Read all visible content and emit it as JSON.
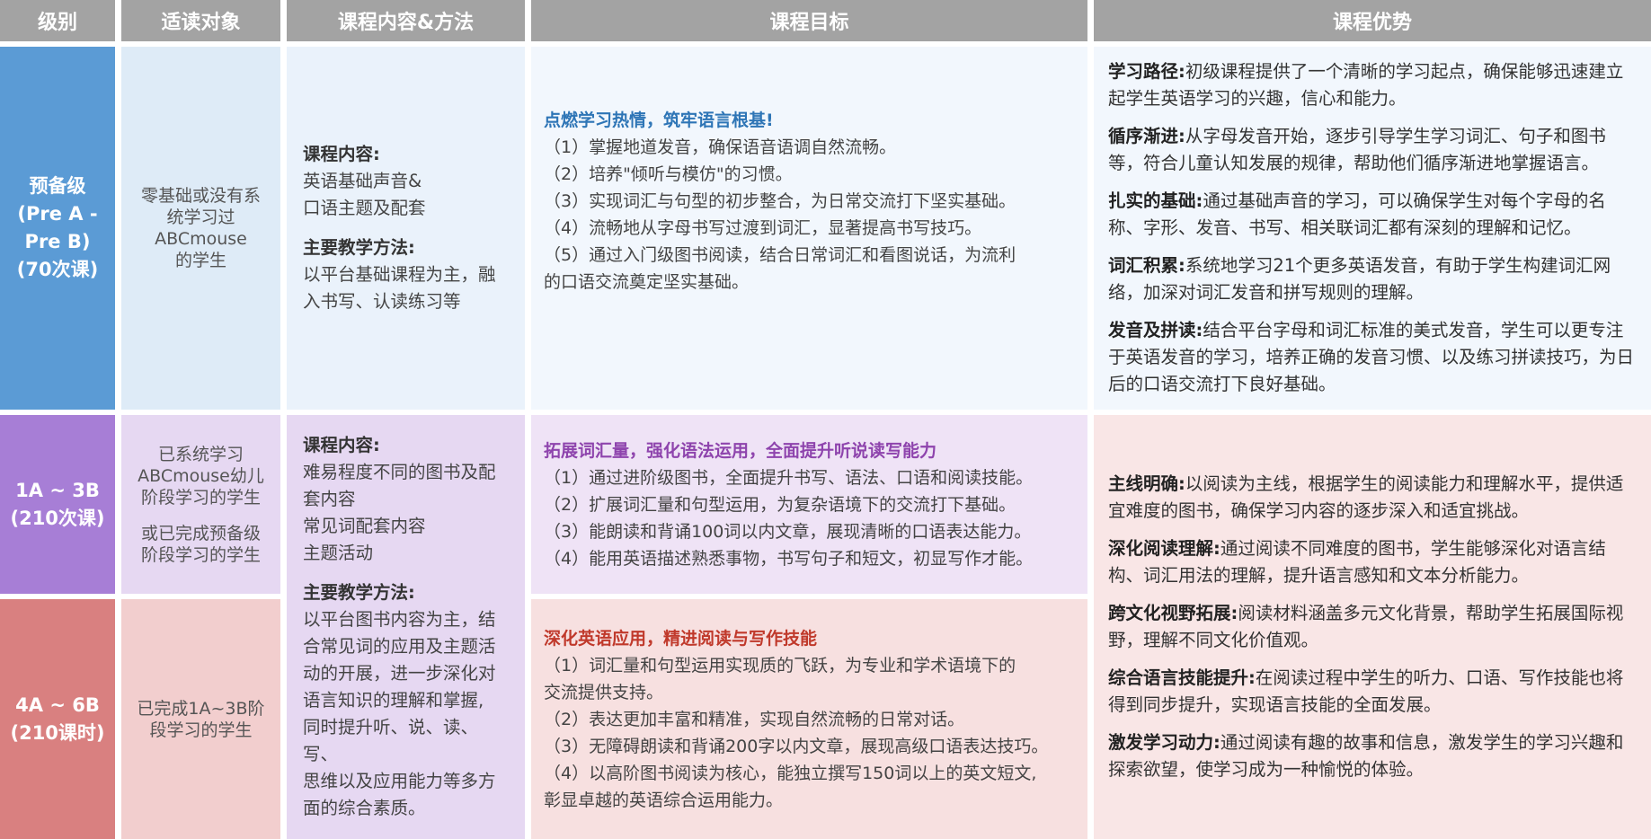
{
  "headers": [
    "级别",
    "适读对象",
    "课程内容&方法",
    "课程目标",
    "课程优势"
  ],
  "rows": {
    "pre": {
      "level": [
        "预备级",
        "(Pre A -",
        "Pre B)",
        "(70次课)"
      ],
      "target": [
        "零基础或没有系",
        "统学习过",
        "ABCmouse",
        "的学生"
      ],
      "content_label": "课程内容:",
      "content_lines": [
        "英语基础声音&",
        "口语主题及配套"
      ],
      "method_label": "主要教学方法:",
      "method_lines": [
        "以平台基础课程为主，融",
        "入书写、认读练习等"
      ],
      "goal_title": "点燃学习热情，筑牢语言根基!",
      "goal_lines": [
        "（1）掌握地道发音，确保语音语调自然流畅。",
        "（2）培养\"倾听与模仿\"的习惯。",
        "（3）实现词汇与句型的初步整合，为日常交流打下坚实基础。",
        "（4）流畅地从字母书写过渡到词汇，显著提高书写技巧。",
        "（5）通过入门级图书阅读，结合日常词汇和看图说话，为流利",
        "的口语交流奠定坚实基础。"
      ],
      "advantages": [
        {
          "key": "学习路径:",
          "text": "初级课程提供了一个清晰的学习起点，确保能够迅速建立起学生英语学习的兴趣，信心和能力。"
        },
        {
          "key": "循序渐进:",
          "text": "从字母发音开始，逐步引导学生学习词汇、句子和图书等，符合儿童认知发展的规律，帮助他们循序渐进地掌握语言。"
        },
        {
          "key": "扎实的基础:",
          "text": "通过基础声音的学习，可以确保学生对每个字母的名称、字形、发音、书写、相关联词汇都有深刻的理解和记忆。"
        },
        {
          "key": "词汇积累:",
          "text": "系统地学习21个更多英语发音，有助于学生构建词汇网络，加深对词汇发音和拼写规则的理解。"
        },
        {
          "key": "发音及拼读:",
          "text": "结合平台字母和词汇标准的美式发音，学生可以更专注于英语发音的学习，培养正确的发音习惯、以及练习拼读技巧，为日后的口语交流打下良好基础。"
        }
      ]
    },
    "a": {
      "level": [
        "1A ~ 3B",
        "(210次课)"
      ],
      "target1": [
        "已系统学习",
        "ABCmouse幼儿",
        "阶段学习的学生"
      ],
      "target2": [
        "或已完成预备级",
        "阶段学习的学生"
      ],
      "goal_title": "拓展词汇量，强化语法运用，全面提升听说读写能力",
      "goal_lines": [
        "（1）通过进阶级图书，全面提升书写、语法、口语和阅读技能。",
        "（2）扩展词汇量和句型运用，为复杂语境下的交流打下基础。",
        "（3）能朗读和背诵100词以内文章，展现清晰的口语表达能力。",
        "（4）能用英语描述熟悉事物，书写句子和短文，初显写作才能。"
      ]
    },
    "b": {
      "level": [
        "4A ~ 6B",
        "(210课时)"
      ],
      "target": [
        "已完成1A~3B阶",
        "段学习的学生"
      ],
      "goal_title": "深化英语应用，精进阅读与写作技能",
      "goal_lines": [
        "（1）词汇量和句型运用实现质的飞跃，为专业和学术语境下的",
        "交流提供支持。",
        "（2）表达更加丰富和精准，实现自然流畅的日常对话。",
        "（3）无障碍朗读和背诵200字以内文章，展现高级口语表达技巧。",
        "（4）以高阶图书阅读为核心，能独立撰写150词以上的英文短文,",
        "彰显卓越的英语综合运用能力。"
      ]
    },
    "ab": {
      "content_label": "课程内容:",
      "content_lines": [
        "难易程度不同的图书及配",
        "套内容",
        "常见词配套内容",
        "主题活动"
      ],
      "method_label": "主要教学方法:",
      "method_lines": [
        "以平台图书内容为主，结",
        "合常见词的应用及主题活",
        "动的开展，进一步深化对",
        "语言知识的理解和掌握,",
        "同时提升听、说、读、写、",
        "思维以及应用能力等多方",
        "面的综合素质。"
      ],
      "advantages": [
        {
          "key": "主线明确:",
          "text": "以阅读为主线，根据学生的阅读能力和理解水平，提供适宜难度的图书，确保学习内容的逐步深入和适宜挑战。"
        },
        {
          "key": "深化阅读理解:",
          "text": "通过阅读不同难度的图书，学生能够深化对语言结构、词汇用法的理解，提升语言感知和文本分析能力。"
        },
        {
          "key": "跨文化视野拓展:",
          "text": "阅读材料涵盖多元文化背景，帮助学生拓展国际视野，理解不同文化价值观。"
        },
        {
          "key": "综合语言技能提升:",
          "text": "在阅读过程中学生的听力、口语、写作技能也将得到同步提升，实现语言技能的全面发展。"
        },
        {
          "key": "激发学习动力:",
          "text": "通过阅读有趣的故事和信息，激发学生的学习兴趣和探索欲望，使学习成为一种愉悦的体验。"
        }
      ]
    }
  },
  "colors": {
    "pre_title": "#2e75b6",
    "a_title": "#8e44ad",
    "b_title": "#c0392b"
  }
}
